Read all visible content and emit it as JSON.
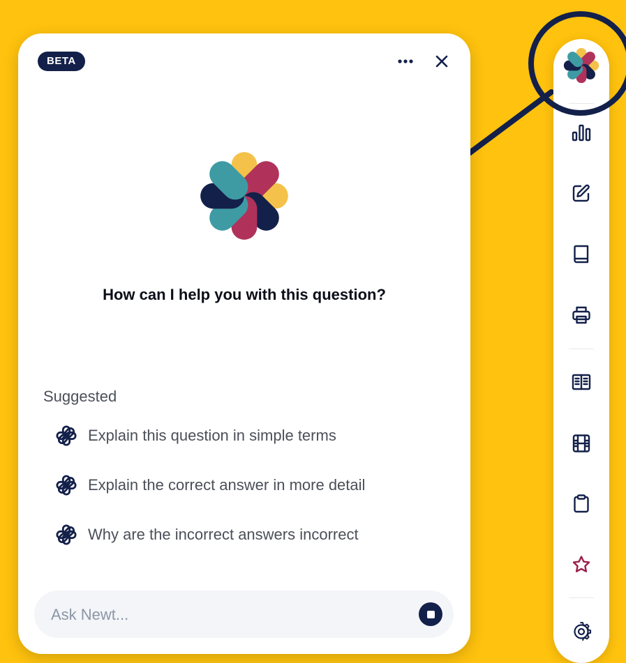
{
  "chat": {
    "badge": "BETA",
    "headline": "How can I help you with this question?",
    "suggested_title": "Suggested",
    "suggestions": [
      "Explain this question in simple terms",
      "Explain the correct answer in more detail",
      "Why are the incorrect answers incorrect"
    ],
    "input_placeholder": "Ask Newt...",
    "more_icon": "more-horizontal-icon",
    "close_icon": "close-icon",
    "send_icon": "stop-icon"
  },
  "toolbar": {
    "items": [
      {
        "icon": "newt-logo-icon"
      },
      {
        "icon": "bar-chart-icon"
      },
      {
        "icon": "edit-icon"
      },
      {
        "icon": "book-icon"
      },
      {
        "icon": "printer-icon"
      },
      {
        "icon": "reader-icon"
      },
      {
        "icon": "film-icon"
      },
      {
        "icon": "clipboard-icon"
      },
      {
        "icon": "star-icon"
      },
      {
        "icon": "settings-icon"
      }
    ]
  },
  "colors": {
    "background": "#FFC20E",
    "navy": "#13204A",
    "teal": "#3E9BA4",
    "gold": "#F4C24A",
    "crimson": "#B0325A",
    "star": "#9A1F49"
  }
}
